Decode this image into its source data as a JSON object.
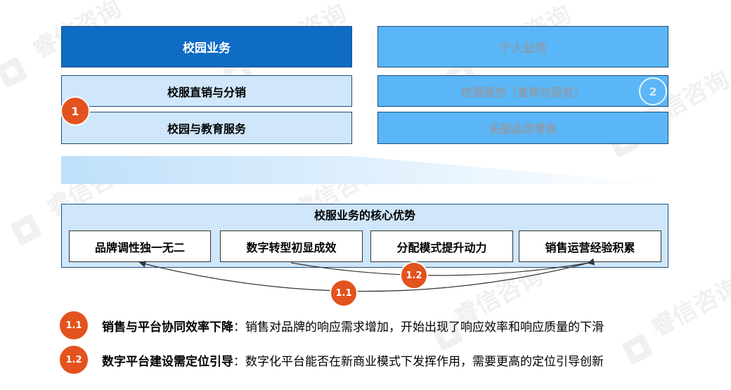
{
  "campus": {
    "header": "校园业务",
    "row1": "校服直销与分销",
    "row2": "校园与教育服务",
    "badge": "1"
  },
  "personal": {
    "header": "个人业务",
    "row1": "校服服务（复购与服务）",
    "row2": "拓展品类零售",
    "badge": "2"
  },
  "advantages": {
    "title": "校服业务的核心优势",
    "items": [
      "品牌调性独一无二",
      "数字转型初显成效",
      "分配模式提升动力",
      "销售运营经验积累"
    ],
    "arc_badge_inner": "1.2",
    "arc_badge_outer": "1.1"
  },
  "notes": [
    {
      "badge": "1.1",
      "title": "销售与平台协同效率下降",
      "text": "：销售对品牌的响应需求增加，开始出现了响应效率和响应质量的下滑"
    },
    {
      "badge": "1.2",
      "title": "数字平台建设需定位引导",
      "text": "：数字化平台能否在新商业模式下发挥作用，需要更高的定位引导创新"
    }
  ],
  "watermark": "睿信咨询",
  "colors": {
    "dark_blue": "#0e6cc4",
    "light_blue": "#cfe6fb",
    "mid_blue": "#5ab6f7",
    "orange": "#e2531d",
    "border_blue": "#1f4e79"
  }
}
